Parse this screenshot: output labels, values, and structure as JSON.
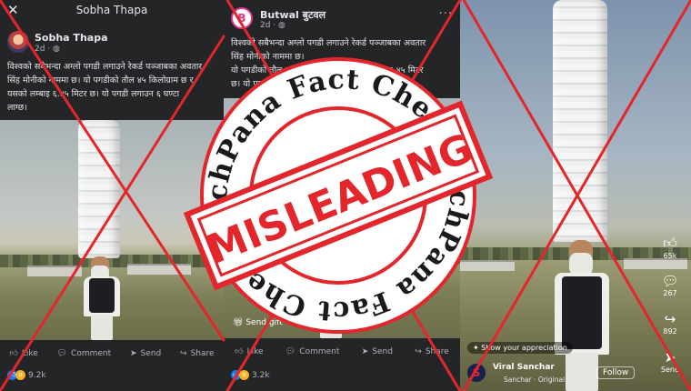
{
  "post1": {
    "topbar_title": "Sobha Thapa",
    "close_icon": "close-icon",
    "author": "Sobha Thapa",
    "time": "2d ·",
    "text_lines": [
      "विश्वको सबैभन्दा अग्लो पगडी लगाउने रेकर्ड पञ्जाबका अवतार",
      "सिंह मोनीको नाममा छ।  यो पगडीको तौल ४५ किलोग्राम छ र",
      "यसको लम्बाइ ६.४५ मिटर छ। यो पगडी लगाउन ६ घण्टा",
      "लाग्छ।"
    ],
    "actions": [
      "Like",
      "Comment",
      "Send",
      "Share"
    ],
    "reaction_count": "9.2k"
  },
  "post2": {
    "author": "Butwal बुटवल",
    "time": "2d ·",
    "text_lines": [
      "विश्वको सबैभन्दा अग्लो पगडी लगाउने रेकर्ड पञ्जाबका अवतार",
      "सिंह मोनीको नाममा छ।",
      "यो पगडीको तौल ४५ किलोग्राम छ र यसको लम्बाइ ६.४५ मिटर",
      "छ। यो पगडी लगाउन ६ घण्टा लाग्छ।"
    ],
    "send_gift": "Send gift",
    "actions": [
      "Like",
      "Comment",
      "Send",
      "Share"
    ],
    "reaction_count": "3.2k"
  },
  "reel": {
    "likes": "65k",
    "comments": "267",
    "shares": "892",
    "send": "Send",
    "appreciation": "Show your appreciation",
    "account": "Viral Sanchar",
    "audio": "Sanchar · Original audio",
    "follow": "Follow"
  },
  "stamp": {
    "brand_top": "TechPana Fact Check",
    "brand_bottom": "TechPana Fact Check",
    "verdict": "MISLEADING",
    "color": "#e3262c"
  }
}
